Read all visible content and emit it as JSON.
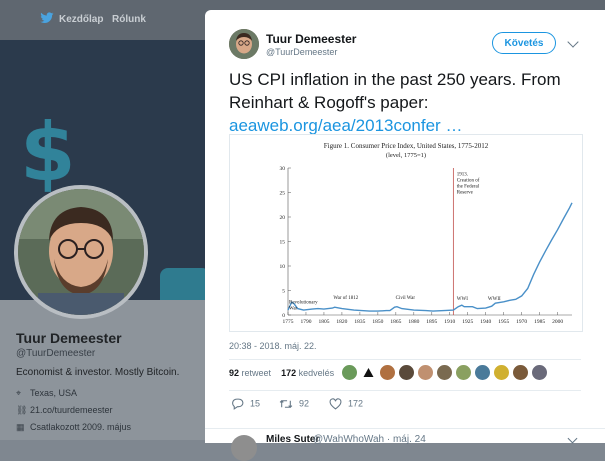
{
  "nav": {
    "home_label": "Kezdőlap",
    "about_label": "Rólunk"
  },
  "profile": {
    "name": "Tuur Demeester",
    "handle": "@TuurDemeester",
    "bio": "Economist & investor. Mostly Bitcoin.",
    "location": "Texas, USA",
    "website": "21.co/tuurdemeester",
    "joined": "Csatlakozott 2009. május"
  },
  "tweet": {
    "author_name": "Tuur Demeester",
    "author_handle": "@TuurDemeester",
    "follow_label": "Követés",
    "text_line1": "US CPI inflation in the past 250 years. From",
    "text_line2": "Reinhart & Rogoff's paper:",
    "link_text": "aeaweb.org/aea/2013confer …",
    "timestamp": "20:38 - 2018. máj. 22.",
    "retweet_count": "92",
    "retweet_label": "retweet",
    "like_count": "172",
    "like_label": "kedvelés",
    "reply_action_count": "15",
    "retweet_action_count": "92",
    "like_action_count": "172"
  },
  "reply": {
    "name": "Miles Suter",
    "handle": "@WahWhoWah · máj. 24"
  },
  "colors": {
    "accent": "#1b95e0",
    "line": "#4a90c8",
    "vline": "#c0504d"
  },
  "chart_data": {
    "type": "line",
    "title": "Figure 1. Consumer Price Index, United States, 1775-2012",
    "subtitle": "(level, 1775=1)",
    "xlabel": "",
    "ylabel": "",
    "xlim": [
      1775,
      2012
    ],
    "ylim": [
      0,
      30
    ],
    "xticks": [
      1775,
      1790,
      1805,
      1820,
      1835,
      1850,
      1865,
      1880,
      1895,
      1910,
      1925,
      1940,
      1955,
      1970,
      1985,
      2000
    ],
    "yticks": [
      0,
      5,
      10,
      15,
      20,
      25,
      30
    ],
    "series": [
      {
        "x": [
          1775,
          1778,
          1780,
          1783,
          1788,
          1795,
          1800,
          1805,
          1812,
          1814,
          1820,
          1830,
          1843,
          1850,
          1857,
          1860,
          1864,
          1866,
          1870,
          1880,
          1890,
          1896,
          1905,
          1913,
          1917,
          1920,
          1922,
          1929,
          1933,
          1940,
          1945,
          1948,
          1955,
          1960,
          1965,
          1970,
          1975,
          1980,
          1985,
          1990,
          1995,
          2000,
          2005,
          2010,
          2012
        ],
        "y": [
          1,
          2.6,
          2.3,
          1.3,
          1.0,
          1.2,
          1.3,
          1.2,
          1.4,
          1.6,
          1.3,
          1.0,
          0.8,
          0.8,
          0.9,
          0.9,
          1.6,
          1.7,
          1.3,
          1.0,
          0.9,
          0.8,
          0.9,
          1.0,
          1.7,
          2.0,
          1.7,
          1.7,
          1.3,
          1.4,
          1.8,
          2.4,
          2.7,
          3.0,
          3.2,
          3.9,
          5.4,
          8.3,
          10.8,
          13.1,
          15.3,
          17.4,
          19.7,
          21.9,
          22.9
        ]
      }
    ],
    "vertical_line": {
      "x": 1913
    },
    "annotations": [
      {
        "text": "Revolutionary War",
        "x": 1775,
        "y": 3.6
      },
      {
        "text": "War of 1812",
        "x": 1812,
        "y": 3.3
      },
      {
        "text": "Civil War",
        "x": 1864,
        "y": 3.3
      },
      {
        "text": "1913. Creation of the Federal Reserve",
        "x": 1915,
        "y": 28.5
      },
      {
        "text": "WWI",
        "x": 1915,
        "y": 3.1
      },
      {
        "text": "WWII",
        "x": 1941,
        "y": 3.1
      }
    ]
  }
}
